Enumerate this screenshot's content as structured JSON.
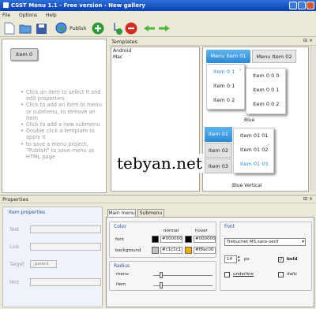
{
  "window": {
    "title": "CSST Menu 1.1 - Free version - New gallery"
  },
  "menu": {
    "file": "File",
    "options": "Options",
    "help": "Help"
  },
  "toolbar": {
    "publish": "Publish"
  },
  "left": {
    "item0": "Item 0",
    "hints": [
      "Click an item to select it and edit properties",
      "Click  to add an item to menu or submenu,  to remove an item",
      "Click  to add a new submenu",
      "Double click a template to apply it",
      " to save a menu project,  \"Publish\" to save menu as HTML page"
    ]
  },
  "templates": {
    "title": "Templates",
    "list": [
      "Android",
      "Mac"
    ],
    "preview": {
      "top": [
        "Menu Item 01",
        "Menu Item 02"
      ],
      "drop1": [
        "Item 0 1",
        "Item 0 1",
        "Item 0 2"
      ],
      "drop2": [
        "Item 0 0 0",
        "Item 0 0 1",
        "Item 0 0 2"
      ],
      "caption1": "Blue",
      "vitems": [
        "Item 01",
        "Item 02",
        "Item 03"
      ],
      "vdrop": [
        "Item 01 01",
        "Item 01 02",
        "Item 01 03"
      ],
      "caption2": "Blue Vertical"
    }
  },
  "watermark": "tebyan.net",
  "properties": {
    "title": "Properties",
    "item_group": "Item properties",
    "text": "Text",
    "link": "Link",
    "target": "Target",
    "target_value": "_parent",
    "hint": "Hint",
    "tabs": [
      "Main menu",
      "Submenu"
    ],
    "color": {
      "title": "Color",
      "normal": "normal",
      "hover": "hover",
      "font": "font",
      "background": "background",
      "font_normal": "#000000",
      "font_hover": "#000000",
      "bg_normal": "#c1c1c1",
      "bg_hover": "#f8ac00",
      "font_normal_color": "#000000",
      "font_hover_color": "#000000",
      "bg_normal_color": "#c1c1c1",
      "bg_hover_color": "#f8ac00"
    },
    "radius": {
      "title": "Radius",
      "menu": "menu",
      "item": "item"
    },
    "font": {
      "title": "Font",
      "family": "Trebuchet MS,sans-serif",
      "size": "14",
      "unit": "px",
      "bold": "bold",
      "underline": "underline",
      "italic": "italic"
    }
  }
}
